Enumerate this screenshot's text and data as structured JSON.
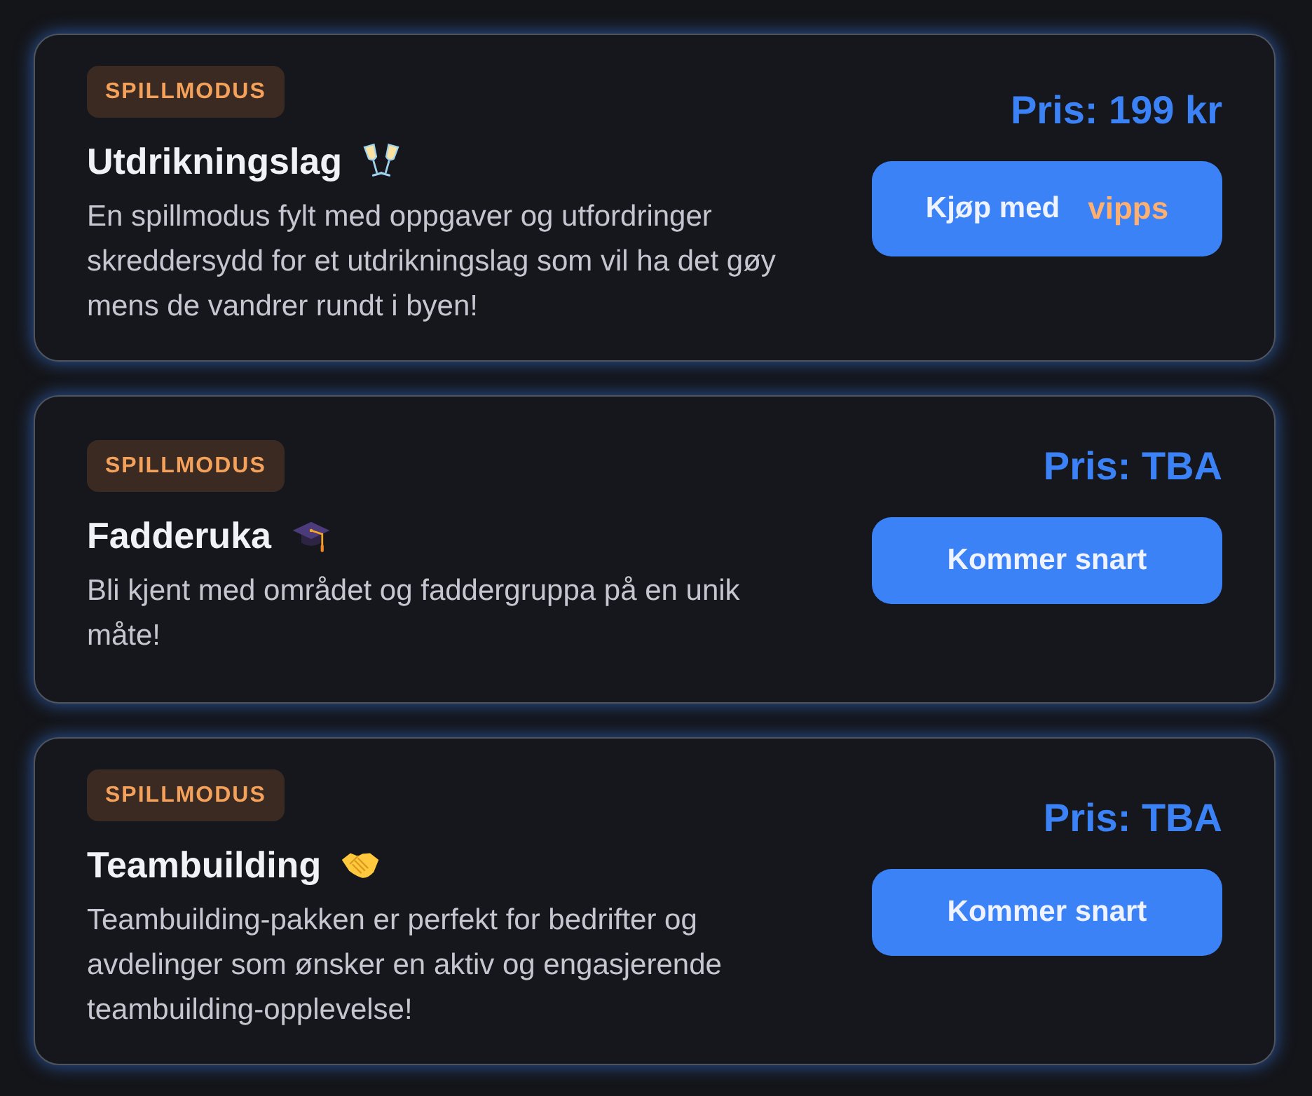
{
  "modes": [
    {
      "tag": "SPILLMODUS",
      "title": "Utdrikningslag",
      "description": "En spillmodus fylt med oppgaver og utfordringer skreddersydd for et utdrikningslag som vil ha det gøy mens de vandrer rundt i byen!",
      "price": "Pris: 199 kr",
      "button": {
        "label": "Kjøp med",
        "logo": "vipps"
      }
    },
    {
      "tag": "SPILLMODUS",
      "title": "Fadderuka",
      "description": "Bli kjent med området og faddergruppa på en unik måte!",
      "price": "Pris: TBA",
      "button": {
        "label": "Kommer snart"
      }
    },
    {
      "tag": "SPILLMODUS",
      "title": "Teambuilding",
      "description": "Teambuilding-pakken er perfekt for bedrifter og avdelinger som ønsker en aktiv og engasjerende teambuilding-opplevelse!",
      "price": "Pris: TBA",
      "button": {
        "label": "Kommer snart"
      }
    }
  ]
}
